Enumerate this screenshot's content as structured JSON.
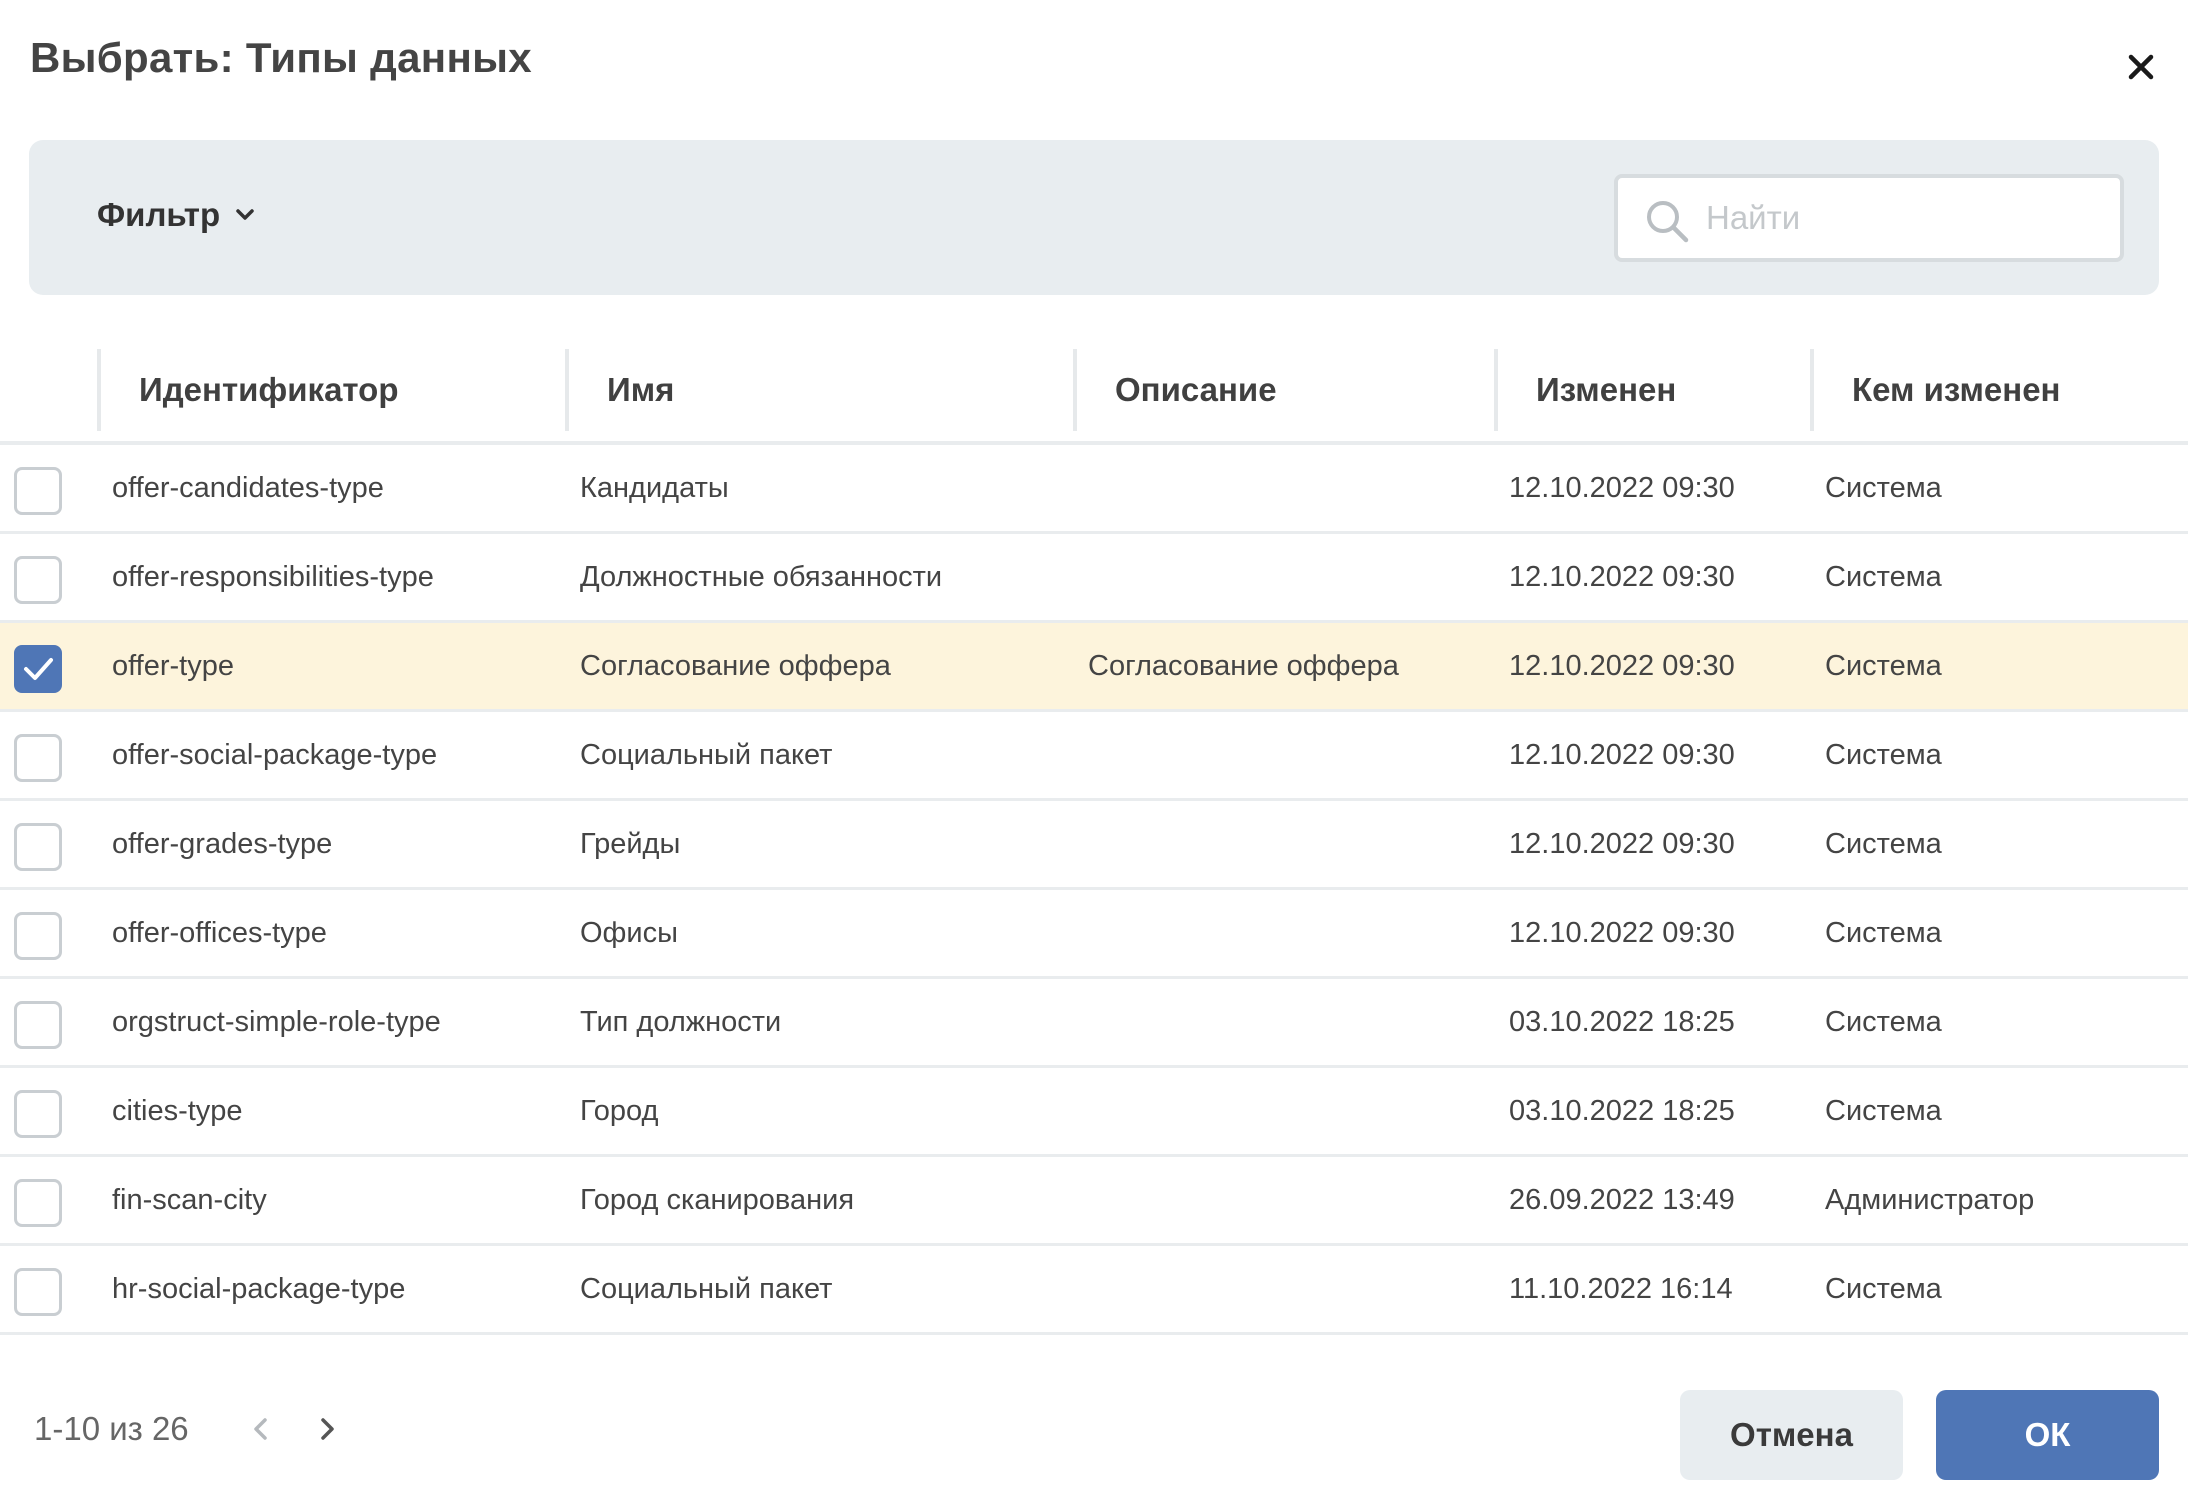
{
  "dialog": {
    "title": "Выбрать: Типы данных"
  },
  "toolbar": {
    "filter_label": "Фильтр",
    "search_placeholder": "Найти",
    "search_value": ""
  },
  "table": {
    "columns": [
      "Идентификатор",
      "Имя",
      "Описание",
      "Изменен",
      "Кем изменен"
    ],
    "rows": [
      {
        "checked": false,
        "id": "offer-candidates-type",
        "name": "Кандидаты",
        "description": "",
        "modified": "12.10.2022 09:30",
        "modified_by": "Система"
      },
      {
        "checked": false,
        "id": "offer-responsibilities-type",
        "name": "Должностные обязанности",
        "description": "",
        "modified": "12.10.2022 09:30",
        "modified_by": "Система"
      },
      {
        "checked": true,
        "id": "offer-type",
        "name": "Согласование оффера",
        "description": "Согласование оффера",
        "modified": "12.10.2022 09:30",
        "modified_by": "Система"
      },
      {
        "checked": false,
        "id": "offer-social-package-type",
        "name": "Социальный пакет",
        "description": "",
        "modified": "12.10.2022 09:30",
        "modified_by": "Система"
      },
      {
        "checked": false,
        "id": "offer-grades-type",
        "name": "Грейды",
        "description": "",
        "modified": "12.10.2022 09:30",
        "modified_by": "Система"
      },
      {
        "checked": false,
        "id": "offer-offices-type",
        "name": "Офисы",
        "description": "",
        "modified": "12.10.2022 09:30",
        "modified_by": "Система"
      },
      {
        "checked": false,
        "id": "orgstruct-simple-role-type",
        "name": "Тип должности",
        "description": "",
        "modified": "03.10.2022 18:25",
        "modified_by": "Система"
      },
      {
        "checked": false,
        "id": "cities-type",
        "name": "Город",
        "description": "",
        "modified": "03.10.2022 18:25",
        "modified_by": "Система"
      },
      {
        "checked": false,
        "id": "fin-scan-city",
        "name": "Город сканирования",
        "description": "",
        "modified": "26.09.2022 13:49",
        "modified_by": "Администратор"
      },
      {
        "checked": false,
        "id": "hr-social-package-type",
        "name": "Социальный пакет",
        "description": "",
        "modified": "11.10.2022 16:14",
        "modified_by": "Система"
      }
    ]
  },
  "pagination": {
    "summary": "1-10 из 26"
  },
  "buttons": {
    "cancel_label": "Отмена",
    "ok_label": "ОК"
  },
  "colors": {
    "accent": "#4f76b6",
    "toolbar_bg": "#e8edf0",
    "selected_row_bg": "#fdf4dc"
  },
  "icons": {
    "close": "close-icon",
    "filter_chevron": "chevron-down-icon",
    "search": "search-icon",
    "check": "check-icon",
    "prev_page": "chevron-left-icon",
    "next_page": "chevron-right-icon"
  }
}
